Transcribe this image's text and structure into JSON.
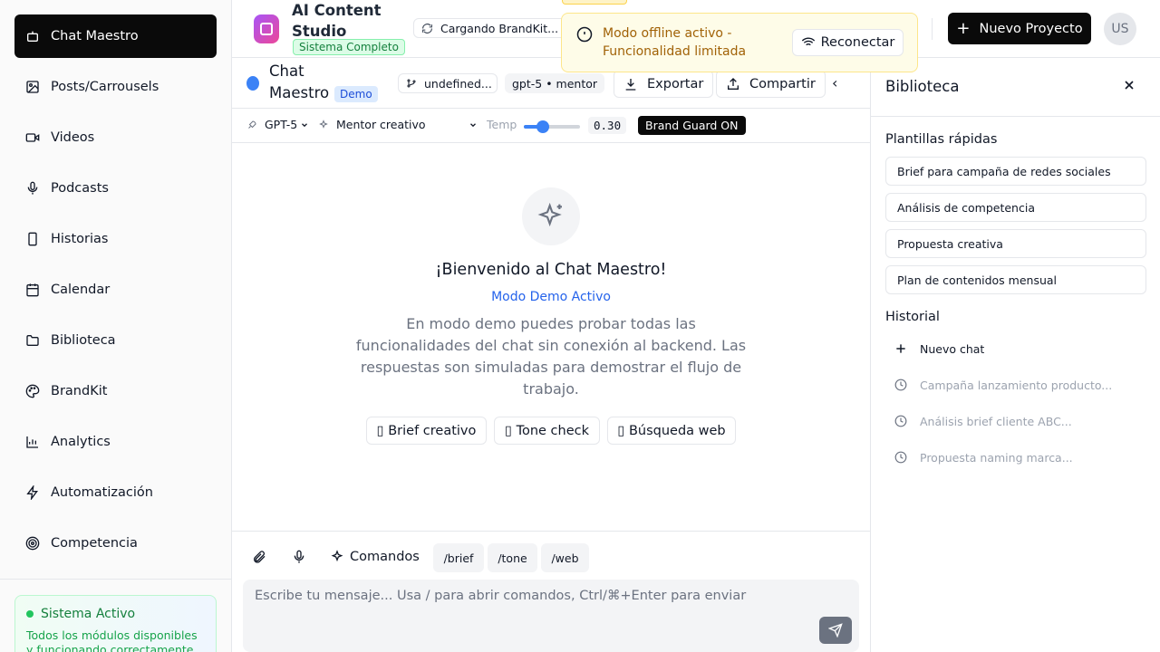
{
  "sidebar": {
    "items": [
      {
        "label": "Chat Maestro",
        "icon": "bot-icon"
      },
      {
        "label": "Posts/Carrousels",
        "icon": "image-icon"
      },
      {
        "label": "Videos",
        "icon": "video-icon"
      },
      {
        "label": "Podcasts",
        "icon": "mic-icon"
      },
      {
        "label": "Historias",
        "icon": "phone-icon"
      },
      {
        "label": "Calendar",
        "icon": "calendar-icon"
      },
      {
        "label": "Biblioteca",
        "icon": "folder-icon"
      },
      {
        "label": "BrandKit",
        "icon": "palette-icon"
      },
      {
        "label": "Analytics",
        "icon": "chart-icon"
      },
      {
        "label": "Automatización",
        "icon": "zap-icon"
      },
      {
        "label": "Competencia",
        "icon": "target-icon"
      }
    ],
    "status": {
      "title": "Sistema Activo",
      "desc": "Todos los módulos disponibles y funcionando correctamente"
    }
  },
  "topbar": {
    "app_title": "AI Content Studio",
    "badge": "Sistema Completo",
    "brandkit_status": "Cargando BrandKit...",
    "new_project": "Nuevo Proyecto",
    "avatar": "US"
  },
  "toast": {
    "message": "Modo offline activo - Funcionalidad limitada",
    "reconnect": "Reconectar"
  },
  "chat": {
    "title": "Chat Maestro",
    "demo_badge": "Demo",
    "branch": "undefined...",
    "model_pill": "gpt-5 • mentor",
    "export": "Exportar",
    "share": "Compartir",
    "collapse": "‹"
  },
  "settings": {
    "model": "GPT-5",
    "persona": "Mentor creativo",
    "temp_label": "Temp",
    "temp_value": "0.30",
    "temp_fraction": 0.3,
    "guard": "Brand Guard ON"
  },
  "welcome": {
    "title": "¡Bienvenido al Chat Maestro!",
    "subtitle": "Modo Demo Activo",
    "desc": "En modo demo puedes probar todas las funcionalidades del chat sin conexión al backend. Las respuestas son simuladas para demostrar el flujo de trabajo.",
    "quick": [
      "▯ Brief creativo",
      "▯ Tone check",
      "▯ Búsqueda web"
    ]
  },
  "input": {
    "commands": "Comandos",
    "slash": [
      "/brief",
      "/tone",
      "/web"
    ],
    "placeholder": "Escribe tu mensaje... Usa / para abrir comandos, Ctrl/⌘+Enter para enviar"
  },
  "panel": {
    "title": "Biblioteca",
    "templates_title": "Plantillas rápidas",
    "templates": [
      "Brief para campaña de redes sociales",
      "Análisis de competencia",
      "Propuesta creativa",
      "Plan de contenidos mensual"
    ],
    "history_title": "Historial",
    "new_chat": "Nuevo chat",
    "history": [
      "Campaña lanzamiento producto...",
      "Análisis brief cliente ABC...",
      "Propuesta naming marca..."
    ]
  }
}
